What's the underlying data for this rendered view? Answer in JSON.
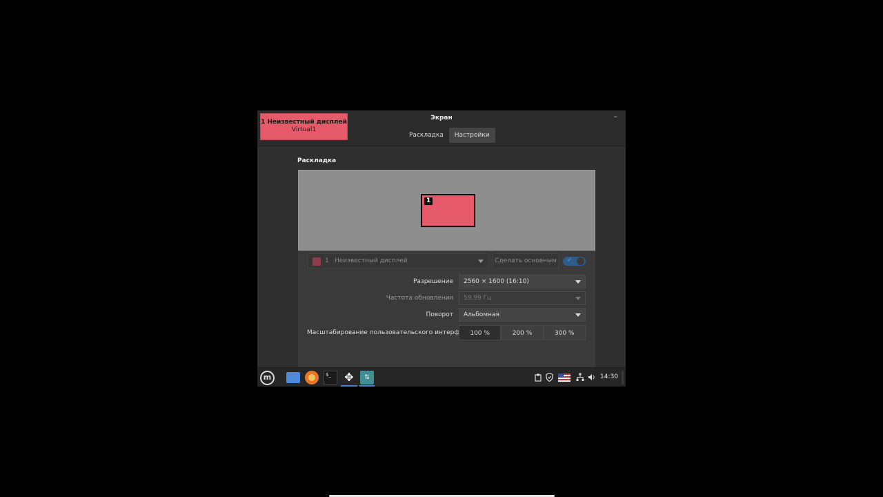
{
  "window": {
    "title": "Экран",
    "minimize_label": "–"
  },
  "display_tag": {
    "line1": "1  Неизвестный дисплей",
    "line2": "Virtual1"
  },
  "tabs": [
    {
      "label": "Раскладка",
      "active": false
    },
    {
      "label": "Настройки",
      "active": true
    }
  ],
  "section": {
    "title": "Раскладка"
  },
  "canvas": {
    "monitor_number": "1"
  },
  "display_selector": {
    "number": "1",
    "name": "Неизвестный дисплей"
  },
  "make_primary_label": "Сделать основным",
  "settings": {
    "resolution_label": "Разрешение",
    "resolution_value": "2560 × 1600 (16:10)",
    "refresh_label": "Частота обновления",
    "refresh_value": "59,99 Гц",
    "rotation_label": "Поворот",
    "rotation_value": "Альбомная",
    "scaling_label": "Масштабирование пользовательского интерфейса",
    "scaling_options": [
      "100 %",
      "200 %",
      "300 %"
    ]
  },
  "taskbar": {
    "menu_glyph": "m",
    "terminal_glyph": "$_",
    "move_glyph": "✥",
    "display_app_glyph": "⇅",
    "clock": "14:30"
  },
  "colors": {
    "accent_red": "#e65a6a",
    "toggle_blue": "#2c5d8c"
  }
}
